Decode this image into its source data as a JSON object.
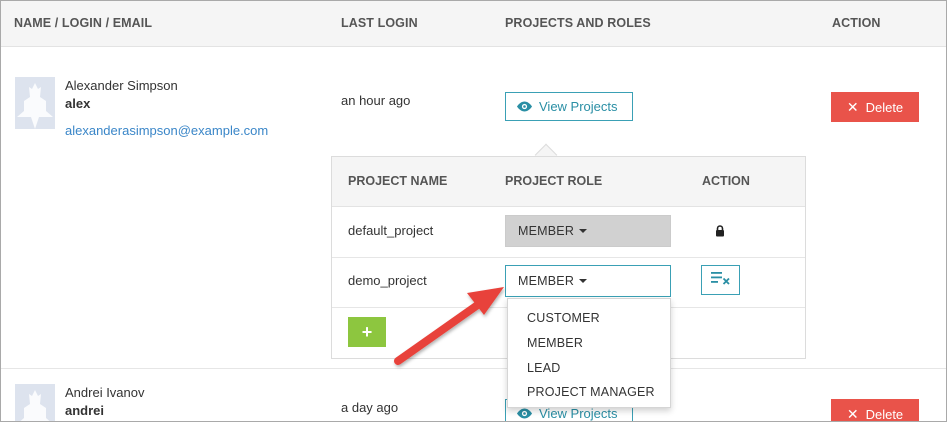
{
  "table": {
    "headers": {
      "name": "NAME / LOGIN / EMAIL",
      "last_login": "LAST LOGIN",
      "projects": "PROJECTS AND ROLES",
      "action": "ACTION"
    }
  },
  "users": [
    {
      "full_name": "Alexander Simpson",
      "login": "alex",
      "email": "alexanderasimpson@example.com",
      "last_login": "an hour ago",
      "view_projects_label": "View Projects",
      "delete_label": "Delete"
    },
    {
      "full_name": "Andrei Ivanov",
      "login": "andrei",
      "last_login": "a day ago",
      "view_projects_label": "View Projects",
      "delete_label": "Delete"
    }
  ],
  "projects_popup": {
    "headers": {
      "name": "PROJECT NAME",
      "role": "PROJECT ROLE",
      "action": "ACTION"
    },
    "rows": [
      {
        "name": "default_project",
        "role": "MEMBER",
        "action_icon": "lock-icon",
        "role_editable": false
      },
      {
        "name": "demo_project",
        "role": "MEMBER",
        "action_icon": "unassign-icon",
        "role_editable": true
      }
    ],
    "add_label": "+"
  },
  "role_dropdown": {
    "options": [
      "CUSTOMER",
      "MEMBER",
      "LEAD",
      "PROJECT MANAGER"
    ]
  },
  "colors": {
    "accent": "#3aa0b5",
    "delete": "#e9534a",
    "add": "#8dc63f",
    "link": "#3a86c8",
    "annotation_arrow": "#e8423a"
  }
}
